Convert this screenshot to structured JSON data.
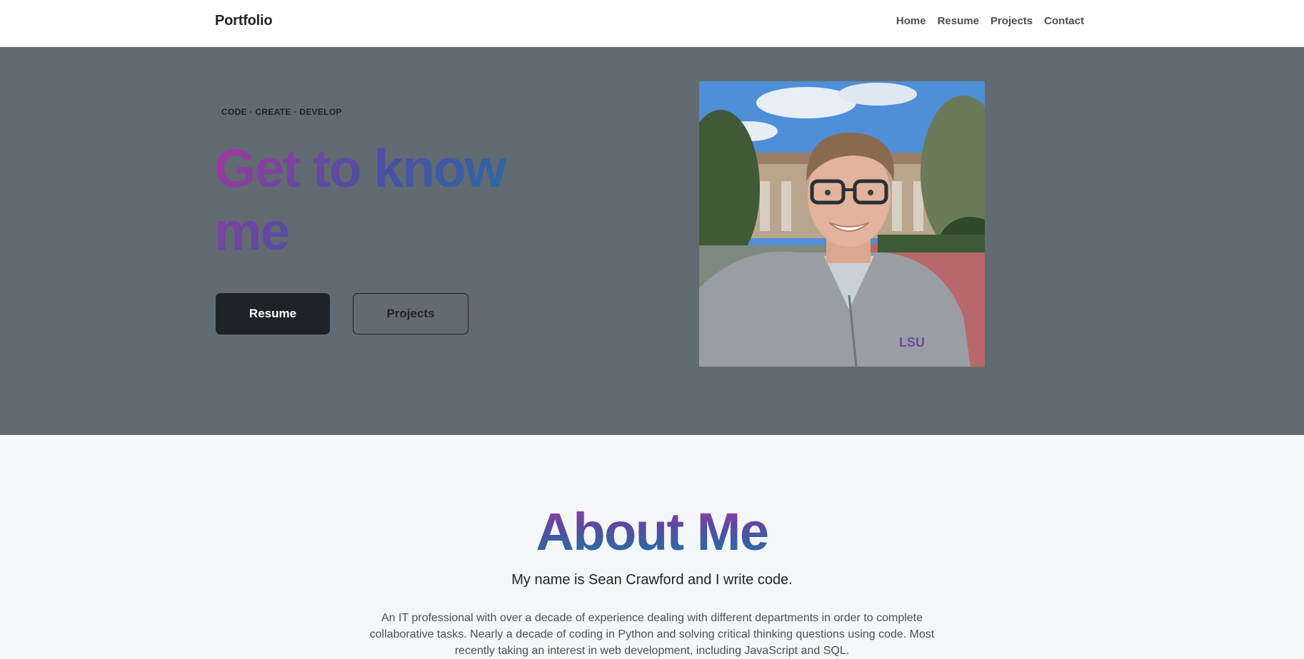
{
  "navbar": {
    "brand": "Portfolio",
    "links": [
      "Home",
      "Resume",
      "Projects",
      "Contact"
    ]
  },
  "hero": {
    "tagline": "CODE · CREATE · DEVELOP",
    "title": "Get to know me",
    "buttons": {
      "primary": "Resume",
      "secondary": "Projects"
    }
  },
  "about": {
    "title": "About Me",
    "subtitle": "My name is Sean Crawford and I write code.",
    "body": "An IT professional with over a decade of experience dealing with different departments in order to complete collaborative tasks. Nearly a decade of coding in Python and solving critical thinking questions using code. Most recently taking an interest in web development, including JavaScript and SQL."
  },
  "colors": {
    "hero_background": "#626b72",
    "gradient_start": "#a8379f",
    "gradient_end": "#1677a6",
    "dark_button": "#1f2327"
  }
}
